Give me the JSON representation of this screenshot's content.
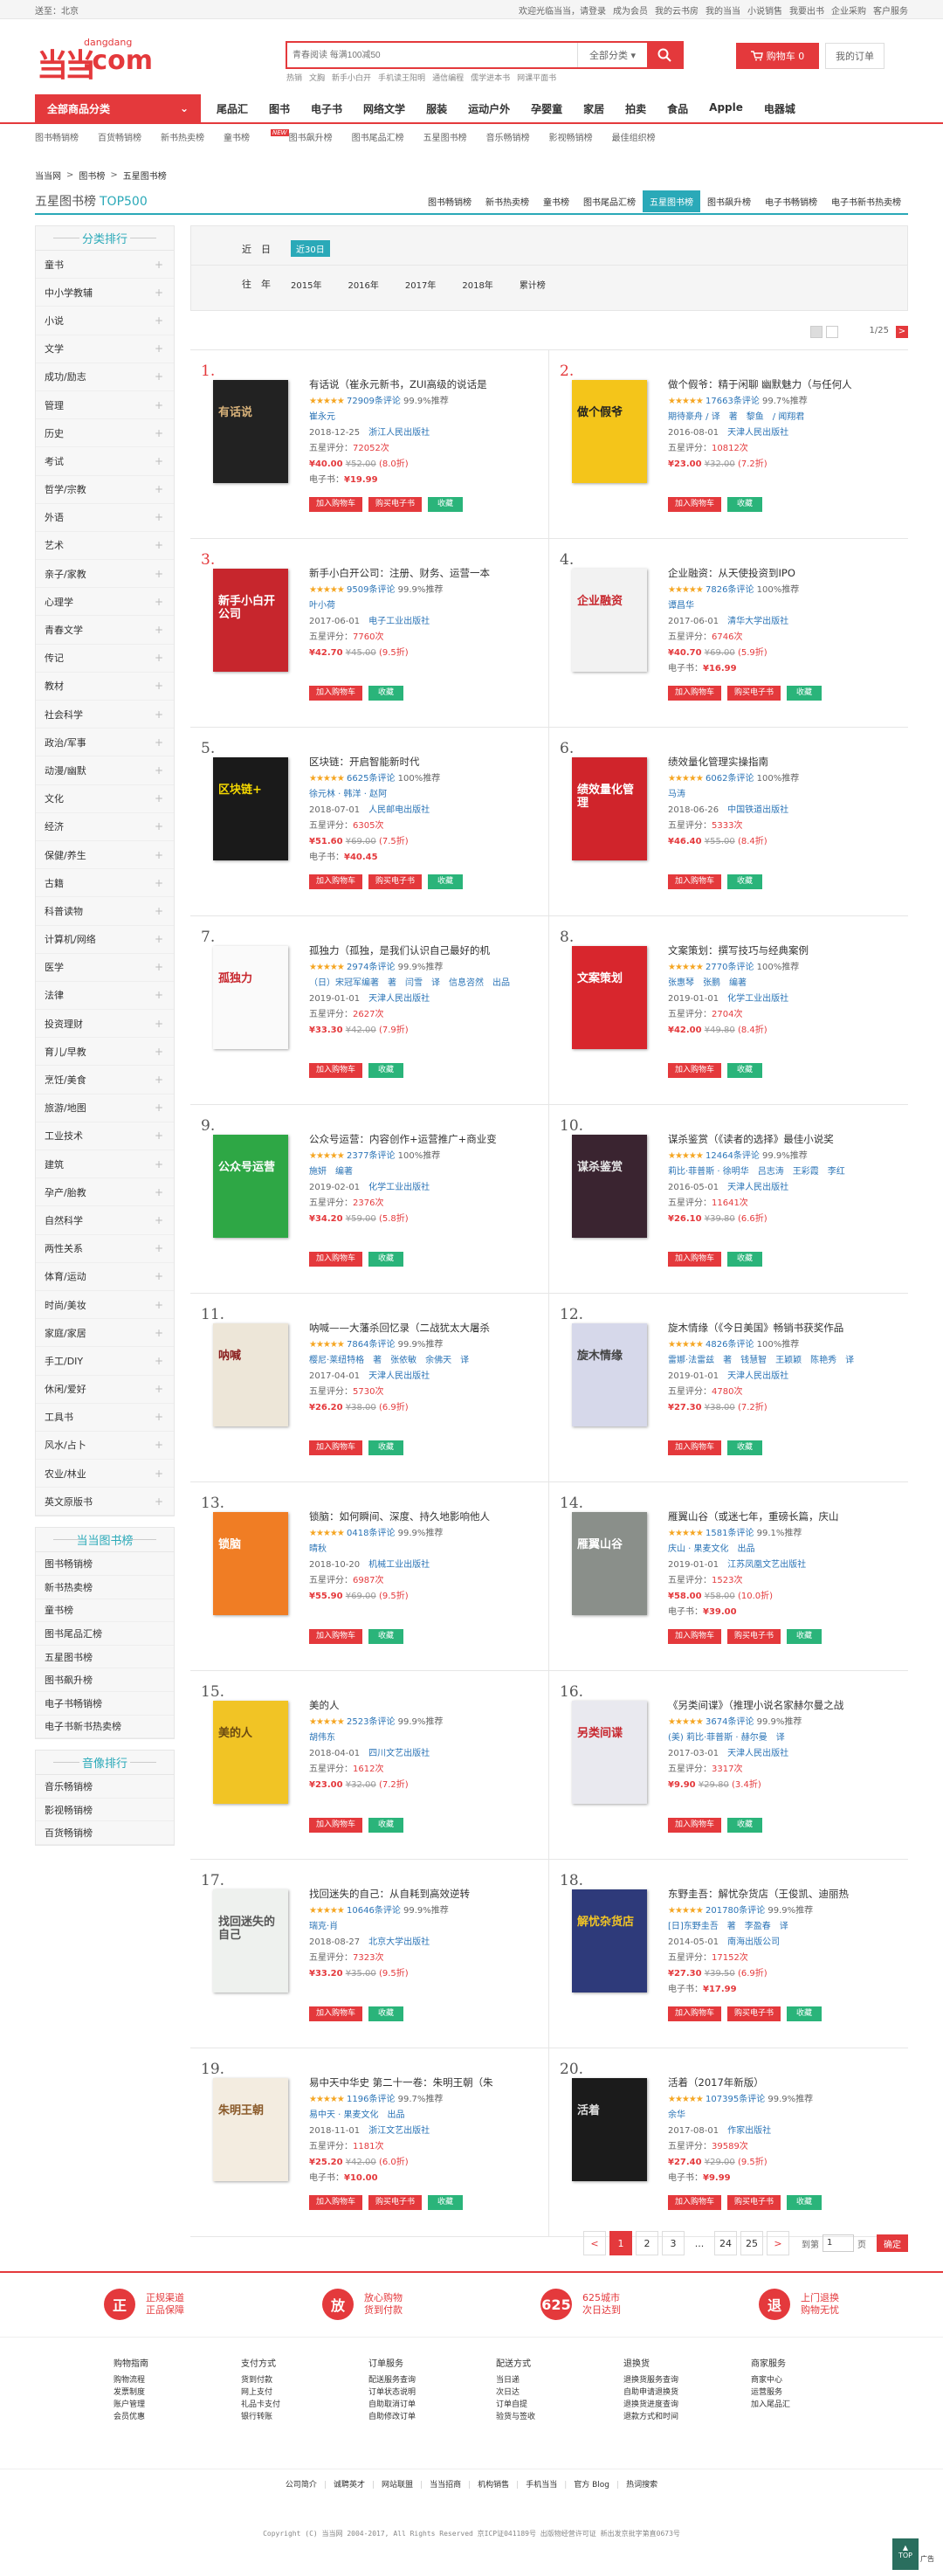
{
  "topbar": {
    "location": "送至：北京",
    "links": [
      "欢迎光临当当，请登录",
      "成为会员",
      "我的云书房",
      "我的当当",
      "小说销售",
      "我要出书",
      "企业采购",
      "客户服务"
    ]
  },
  "header": {
    "logo_small": "dangdang",
    "logo_com": ".com",
    "search_placeholder": "青春阅读 每满100减50",
    "search_category": "全部分类",
    "hot_words": [
      "热销",
      "文胸",
      "新手小白开",
      "手机读王阳明",
      "通信编程",
      "儒学进本书",
      "网课平面书"
    ],
    "cart": "购物车 0",
    "orders": "我的订单"
  },
  "nav": {
    "all": "全部商品分类",
    "links": [
      "尾品汇",
      "图书",
      "电子书",
      "网络文学",
      "服装",
      "运动户外",
      "孕婴童",
      "家居",
      "拍卖",
      "食品",
      "Apple",
      "电器城"
    ],
    "sub": [
      "图书畅销榜",
      "百货畅销榜",
      "新书热卖榜",
      "童书榜",
      "图书飙升榜",
      "图书尾品汇榜",
      "五星图书榜",
      "音乐畅销榜",
      "影视畅销榜",
      "最佳组织榜"
    ],
    "new_badge": "NEW"
  },
  "crumb": [
    "当当网",
    ">",
    "图书榜",
    ">",
    "五星图书榜"
  ],
  "titlebar": {
    "title": "五星图书榜",
    "top": "TOP500",
    "tabs": [
      "图书畅销榜",
      "新书热卖榜",
      "童书榜",
      "图书尾品汇榜",
      "五星图书榜",
      "图书飙升榜",
      "电子书畅销榜",
      "电子书新书热卖榜"
    ]
  },
  "sidebar": {
    "head1": "分类排行",
    "cats": [
      "童书",
      "中小学教辅",
      "小说",
      "文学",
      "成功/励志",
      "管理",
      "历史",
      "考试",
      "哲学/宗教",
      "外语",
      "艺术",
      "亲子/家教",
      "心理学",
      "青春文学",
      "传记",
      "教材",
      "社会科学",
      "政治/军事",
      "动漫/幽默",
      "文化",
      "经济",
      "保健/养生",
      "古籍",
      "科普读物",
      "计算机/网络",
      "医学",
      "法律",
      "投资理财",
      "育儿/早教",
      "烹饪/美食",
      "旅游/地图",
      "工业技术",
      "建筑",
      "孕产/胎教",
      "自然科学",
      "两性关系",
      "体育/运动",
      "时尚/美妆",
      "家庭/家居",
      "手工/DIY",
      "休闲/爱好",
      "工具书",
      "风水/占卜",
      "农业/林业",
      "英文原版书"
    ],
    "head2": "当当图书榜",
    "lists": [
      "图书畅销榜",
      "新书热卖榜",
      "童书榜",
      "图书尾品汇榜",
      "五星图书榜",
      "图书飙升榜",
      "电子书畅销榜",
      "电子书新书热卖榜"
    ],
    "head3": "音像排行",
    "av": [
      "音乐畅销榜",
      "影视畅销榜",
      "百货畅销榜"
    ]
  },
  "filter": {
    "recent_label": "近　日",
    "recent": "近30日",
    "year_label": "往　年",
    "years": [
      "2015年",
      "2016年",
      "2017年",
      "2018年",
      "累计榜"
    ]
  },
  "view": {
    "page": "1/25",
    "next": ">"
  },
  "labels": {
    "five_star": "五星评分：",
    "ebook": "电子书：",
    "add_cart": "加入购物车",
    "buy_ebook": "购买电子书",
    "fav": "收藏",
    "recommend": "推荐"
  },
  "books": [
    {
      "rank": "1.",
      "title": "有话说（崔永元新书，ZUI高级的说话是",
      "reviews": "72909条评论",
      "rec": "99.9%推荐",
      "author": "崔永元",
      "date": "2018-12-25",
      "pub": "浙江人民出版社",
      "five": "72052次",
      "price": "¥40.00",
      "orig": "¥52.00",
      "disc": "(8.0折)",
      "ebook": "¥19.99",
      "color": "#222",
      "ctext": "有话说",
      "ctc": "#d8b27a",
      "btns": 3
    },
    {
      "rank": "2.",
      "title": "做个假爷：精于闲聊 幽默魅力（与任何人",
      "reviews": "17663条评论",
      "rec": "99.7%推荐",
      "author": "期待豪舟 / 译　著　黎鱼　/ 闻翔君",
      "date": "2016-08-01",
      "pub": "天津人民出版社",
      "five": "10812次",
      "price": "¥23.00",
      "orig": "¥32.00",
      "disc": "(7.2折)",
      "ebook": "",
      "color": "#f4c51a",
      "ctext": "做个假爷",
      "ctc": "#222",
      "btns": 2
    },
    {
      "rank": "3.",
      "title": "新手小白开公司：注册、财务、运营一本",
      "reviews": "9509条评论",
      "rec": "99.9%推荐",
      "author": "叶小荷",
      "date": "2017-06-01",
      "pub": "电子工业出版社",
      "five": "7760次",
      "price": "¥42.70",
      "orig": "¥45.00",
      "disc": "(9.5折)",
      "ebook": "",
      "color": "#c7262d",
      "ctext": "新手小白开公司",
      "ctc": "#fff",
      "btns": 2
    },
    {
      "rank": "4.",
      "title": "企业融资：从天使投资到IPO",
      "reviews": "7826条评论",
      "rec": "100%推荐",
      "author": "谭昌华",
      "date": "2017-06-01",
      "pub": "清华大学出版社",
      "five": "6746次",
      "price": "¥40.70",
      "orig": "¥69.00",
      "disc": "(5.9折)",
      "ebook": "¥16.99",
      "color": "#f2f2f2",
      "ctext": "企业融资",
      "ctc": "#c7262d",
      "btns": 3
    },
    {
      "rank": "5.",
      "title": "区块链：开启智能新时代",
      "reviews": "6625条评论",
      "rec": "100%推荐",
      "author": "徐元林 · 韩洋 · 赵阿",
      "date": "2018-07-01",
      "pub": "人民邮电出版社",
      "five": "6305次",
      "price": "¥51.60",
      "orig": "¥69.00",
      "disc": "(7.5折)",
      "ebook": "¥40.45",
      "color": "#1a1a1a",
      "ctext": "区块链+",
      "ctc": "#f5d800",
      "btns": 3
    },
    {
      "rank": "6.",
      "title": "绩效量化管理实操指南",
      "reviews": "6062条评论",
      "rec": "100%推荐",
      "author": "马涛",
      "date": "2018-06-26",
      "pub": "中国铁道出版社",
      "five": "5333次",
      "price": "¥46.40",
      "orig": "¥55.00",
      "disc": "(8.4折)",
      "ebook": "",
      "color": "#d0242b",
      "ctext": "绩效量化管理",
      "ctc": "#fff",
      "btns": 2
    },
    {
      "rank": "7.",
      "title": "孤独力（孤独，是我们认识自己最好的机",
      "reviews": "2974条评论",
      "rec": "99.9%推荐",
      "author": "（日）宋冠军编著　著　闫雪　译　信息咨然　出品",
      "date": "2019-01-01",
      "pub": "天津人民出版社",
      "five": "2627次",
      "price": "¥33.30",
      "orig": "¥42.00",
      "disc": "(7.9折)",
      "ebook": "",
      "color": "#fafafa",
      "ctext": "孤独力",
      "ctc": "#c7262d",
      "btns": 2
    },
    {
      "rank": "8.",
      "title": "文案策划：撰写技巧与经典案例",
      "reviews": "2770条评论",
      "rec": "100%推荐",
      "author": "张惠琴　张鹏　编著",
      "date": "2019-01-01",
      "pub": "化学工业出版社",
      "five": "2704次",
      "price": "¥42.00",
      "orig": "¥49.80",
      "disc": "(8.4折)",
      "ebook": "",
      "color": "#d8262d",
      "ctext": "文案策划",
      "ctc": "#fff",
      "btns": 2
    },
    {
      "rank": "9.",
      "title": "公众号运营：内容创作+运营推广+商业变",
      "reviews": "2377条评论",
      "rec": "100%推荐",
      "author": "施妍　编著",
      "date": "2019-02-01",
      "pub": "化学工业出版社",
      "five": "2376次",
      "price": "¥34.20",
      "orig": "¥59.00",
      "disc": "(5.8折)",
      "ebook": "",
      "color": "#2ea745",
      "ctext": "公众号运营",
      "ctc": "#fff",
      "btns": 2
    },
    {
      "rank": "10.",
      "title": "谋杀鉴赏（《读者的选择》最佳小说奖",
      "reviews": "12464条评论",
      "rec": "99.9%推荐",
      "author": "莉比·菲普斯 · 徐明华　吕志涛　王彩霞　李红",
      "date": "2016-05-01",
      "pub": "天津人民出版社",
      "five": "11641次",
      "price": "¥26.10",
      "orig": "¥39.80",
      "disc": "(6.6折)",
      "ebook": "",
      "color": "#3a2430",
      "ctext": "谋杀鉴赏",
      "ctc": "#e8e8e8",
      "btns": 2
    },
    {
      "rank": "11.",
      "title": "呐喊——大藩杀回忆录（二战犹太大屠杀",
      "reviews": "7864条评论",
      "rec": "99.9%推荐",
      "author": "樱尼·莱纽特格　著　张依敏　余佛天　译",
      "date": "2017-04-01",
      "pub": "天津人民出版社",
      "five": "5730次",
      "price": "¥26.20",
      "orig": "¥38.00",
      "disc": "(6.9折)",
      "ebook": "",
      "color": "#ede6d8",
      "ctext": "呐喊",
      "ctc": "#8a1f1f",
      "btns": 2
    },
    {
      "rank": "12.",
      "title": "旋木情缘（《今日美国》畅销书获奖作品",
      "reviews": "4826条评论",
      "rec": "100%推荐",
      "author": "雷娜·法雷兹　著　钱慧智　王颖颖　陈艳秀　译",
      "date": "2019-01-01",
      "pub": "天津人民出版社",
      "five": "4780次",
      "price": "¥27.30",
      "orig": "¥38.00",
      "disc": "(7.2折)",
      "ebook": "",
      "color": "#d6d8ea",
      "ctext": "旋木情缘",
      "ctc": "#444",
      "btns": 2
    },
    {
      "rank": "13.",
      "title": "锁脑：如何瞬间、深度、持久地影响他人",
      "reviews": "0418条评论",
      "rec": "99.9%推荐",
      "author": "晴秋",
      "date": "2018-10-20",
      "pub": "机械工业出版社",
      "five": "6987次",
      "price": "¥55.90",
      "orig": "¥69.00",
      "disc": "(9.5折)",
      "ebook": "",
      "color": "#f07d24",
      "ctext": "锁脑",
      "ctc": "#fff",
      "btns": 2
    },
    {
      "rank": "14.",
      "title": "雁翼山谷（或迷七年，重磅长篇，庆山",
      "reviews": "1581条评论",
      "rec": "99.1%推荐",
      "author": "庆山 · 果麦文化　出品",
      "date": "2019-01-01",
      "pub": "江苏凤凰文艺出版社",
      "five": "1523次",
      "price": "¥58.00",
      "orig": "¥58.00",
      "disc": "(10.0折)",
      "ebook": "¥39.00",
      "color": "#8a8f8a",
      "ctext": "雁翼山谷",
      "ctc": "#fff",
      "btns": 3
    },
    {
      "rank": "15.",
      "title": "美的人",
      "reviews": "2523条评论",
      "rec": "99.9%推荐",
      "author": "胡伟东",
      "date": "2018-04-01",
      "pub": "四川文艺出版社",
      "five": "1612次",
      "price": "¥23.00",
      "orig": "¥32.00",
      "disc": "(7.2折)",
      "ebook": "",
      "color": "#f1c425",
      "ctext": "美的人",
      "ctc": "#6b4a12",
      "btns": 2
    },
    {
      "rank": "16.",
      "title": "《另类间谍》（推理小说名家赫尔曼之战",
      "reviews": "3674条评论",
      "rec": "99.9%推荐",
      "author": "(美) 莉比·菲普斯 · 赫尔曼　译",
      "date": "2017-03-01",
      "pub": "天津人民出版社",
      "five": "3317次",
      "price": "¥9.90",
      "orig": "¥29.80",
      "disc": "(3.4折)",
      "ebook": "",
      "color": "#e9e9ef",
      "ctext": "另类间谍",
      "ctc": "#c7262d",
      "btns": 2
    },
    {
      "rank": "17.",
      "title": "找回迷失的自己：从自耗到高效逆转",
      "reviews": "10646条评论",
      "rec": "99.9%推荐",
      "author": "瑞克·肖",
      "date": "2018-08-27",
      "pub": "北京大学出版社",
      "five": "7323次",
      "price": "¥33.20",
      "orig": "¥35.00",
      "disc": "(9.5折)",
      "ebook": "",
      "color": "#eef1ee",
      "ctext": "找回迷失的自己",
      "ctc": "#555",
      "btns": 2
    },
    {
      "rank": "18.",
      "title": "东野圭吾：解忧杂货店（王俊凯、迪丽热",
      "reviews": "201780条评论",
      "rec": "99.9%推荐",
      "author": "[日]东野圭吾　著　李盈春　译",
      "date": "2014-05-01",
      "pub": "南海出版公司",
      "five": "17152次",
      "price": "¥27.30",
      "orig": "¥39.50",
      "disc": "(6.9折)",
      "ebook": "¥17.99",
      "color": "#2e3a7a",
      "ctext": "解忧杂货店",
      "ctc": "#f1c425",
      "btns": 3
    },
    {
      "rank": "19.",
      "title": "易中天中华史 第二十一卷：朱明王朝（朱",
      "reviews": "1196条评论",
      "rec": "99.7%推荐",
      "author": "易中天 · 果麦文化　出品",
      "date": "2018-11-01",
      "pub": "浙江文艺出版社",
      "five": "1181次",
      "price": "¥25.20",
      "orig": "¥42.00",
      "disc": "(6.0折)",
      "ebook": "¥10.00",
      "color": "#f3ece0",
      "ctext": "朱明王朝",
      "ctc": "#8a5a2a",
      "btns": 3
    },
    {
      "rank": "20.",
      "title": "活着（2017年新版）",
      "reviews": "107395条评论",
      "rec": "99.9%推荐",
      "author": "余华",
      "date": "2017-08-01",
      "pub": "作家出版社",
      "five": "39589次",
      "price": "¥27.40",
      "orig": "¥29.00",
      "disc": "(9.5折)",
      "ebook": "¥9.99",
      "color": "#1b1b1b",
      "ctext": "活着",
      "ctc": "#ddd",
      "btns": 3
    }
  ],
  "pager": {
    "prev": "<",
    "pages": [
      "1",
      "2",
      "3",
      "...",
      "24",
      "25"
    ],
    "next": ">",
    "goto": "到第",
    "page_val": "1",
    "page_unit": "页",
    "ok": "确定"
  },
  "promo": [
    {
      "icon": "正",
      "t1": "正规渠道",
      "t2": "正品保障"
    },
    {
      "icon": "放",
      "t1": "放心购物",
      "t2": "货到付款"
    },
    {
      "icon": "625",
      "t1": "625城市",
      "t2": "次日达到"
    },
    {
      "icon": "退",
      "t1": "上门退换",
      "t2": "购物无忧"
    }
  ],
  "help": [
    {
      "h": "购物指南",
      "items": [
        "购物流程",
        "发票制度",
        "账户管理",
        "会员优惠"
      ]
    },
    {
      "h": "支付方式",
      "items": [
        "货到付款",
        "网上支付",
        "礼品卡支付",
        "银行转账"
      ]
    },
    {
      "h": "订单服务",
      "items": [
        "配送服务查询",
        "订单状态说明",
        "自助取消订单",
        "自助修改订单"
      ]
    },
    {
      "h": "配送方式",
      "items": [
        "当日递",
        "次日达",
        "订单自提",
        "验货与签收"
      ]
    },
    {
      "h": "退换货",
      "items": [
        "退换货服务查询",
        "自助申请退换货",
        "退换货进度查询",
        "退款方式和时间"
      ]
    },
    {
      "h": "商家服务",
      "items": [
        "商家中心",
        "运营服务",
        "加入尾品汇"
      ]
    }
  ],
  "footer_links": [
    "公司简介",
    "诚聘英才",
    "网站联盟",
    "当当招商",
    "机构销售",
    "手机当当",
    "官方 Blog",
    "热词搜索"
  ],
  "copyright": "Copyright (C) 当当网 2004-2017, All Rights Reserved   京ICP证041189号 出版物经营许可证 新出发京批字第直0673号",
  "top_label": "TOP",
  "ad_label": "广告"
}
